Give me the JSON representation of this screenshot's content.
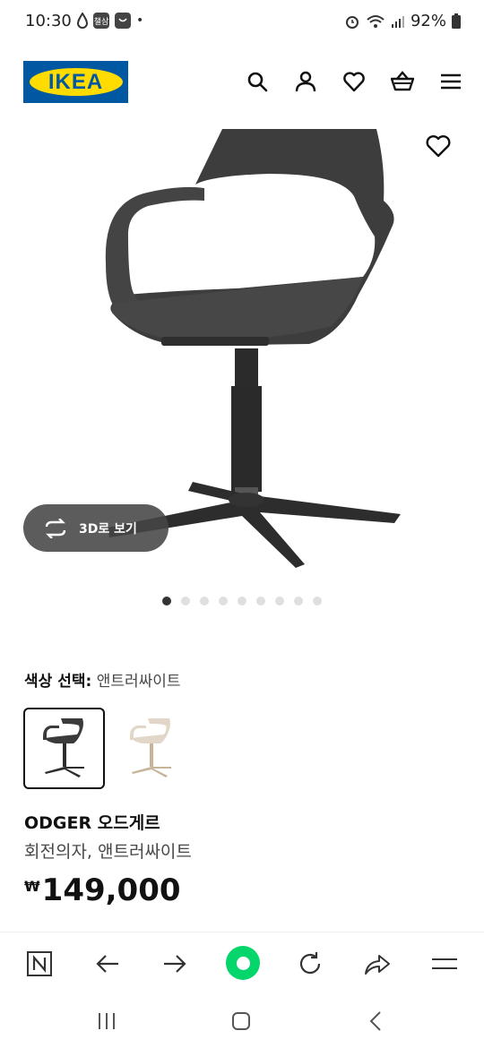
{
  "status_bar": {
    "time": "10:30",
    "battery": "92%",
    "notif_label": "챌삼"
  },
  "header": {
    "logo_text": "IKEA",
    "icons": [
      "search-icon",
      "account-icon",
      "wishlist-icon",
      "cart-icon",
      "menu-icon"
    ]
  },
  "gallery": {
    "view3d_label": "3D로 보기",
    "image_count": 9,
    "active_index": 0
  },
  "color_select": {
    "label": "색상 선택:",
    "value": "앤트러싸이트",
    "options": [
      "anthracite",
      "white-beige"
    ]
  },
  "product": {
    "name": "ODGER 오드게르",
    "description": "회전의자, 앤트러싸이트",
    "currency": "₩",
    "price": "149,000"
  },
  "browser_toolbar": {
    "icons": [
      "n-icon",
      "back-arrow-icon",
      "forward-arrow-icon",
      "home-icon",
      "reload-icon",
      "share-icon",
      "menu-icon"
    ]
  },
  "colors": {
    "ikea_blue": "#0058a3",
    "ikea_yellow": "#ffdb00",
    "browser_green": "#05d66b",
    "chair_dark": "#3b3b3b",
    "chair_light": "#e2d6c9"
  }
}
